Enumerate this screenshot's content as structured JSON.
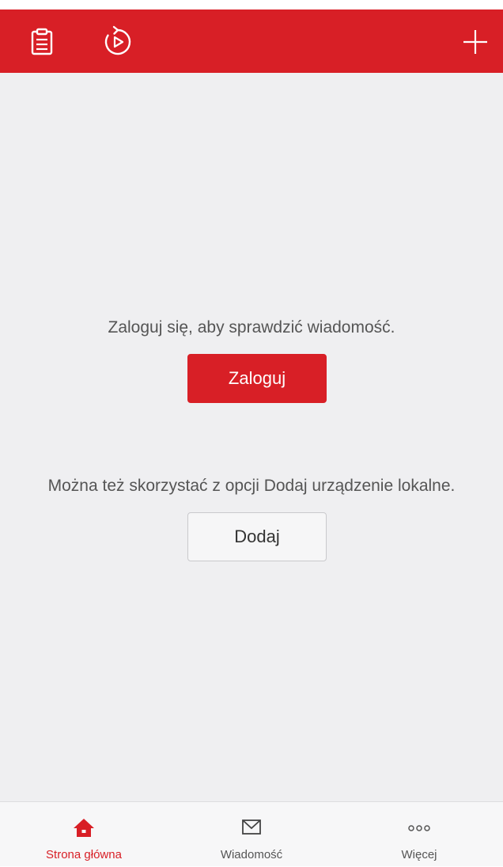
{
  "colors": {
    "accent": "#d81f26",
    "background": "#efeff1",
    "text": "#555555"
  },
  "header": {
    "left_icons": [
      "clipboard-icon",
      "playback-icon"
    ],
    "right_icon": "plus-icon"
  },
  "main": {
    "login_message": "Zaloguj się, aby sprawdzić wiadomość.",
    "login_button_label": "Zaloguj",
    "alternative_message": "Można też skorzystać z opcji Dodaj urządzenie lokalne.",
    "add_button_label": "Dodaj"
  },
  "bottom_nav": {
    "items": [
      {
        "label": "Strona główna",
        "icon": "home-icon",
        "active": true
      },
      {
        "label": "Wiadomość",
        "icon": "envelope-icon",
        "active": false
      },
      {
        "label": "Więcej",
        "icon": "more-icon",
        "active": false
      }
    ]
  }
}
